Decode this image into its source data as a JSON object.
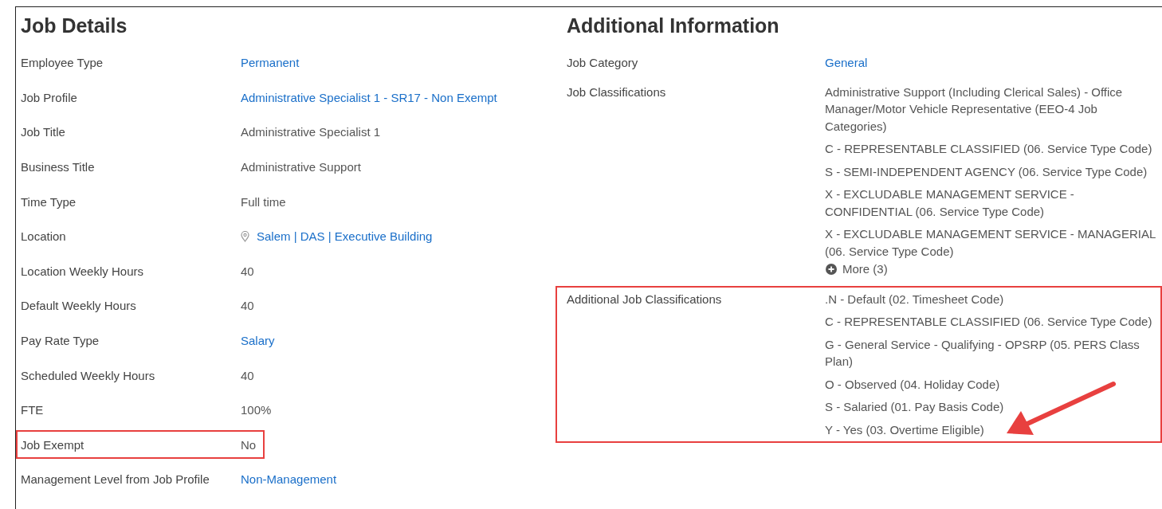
{
  "job_details": {
    "title": "Job Details",
    "fields": [
      {
        "label": "Employee Type",
        "value": "Permanent",
        "kind": "link",
        "highlighted": false
      },
      {
        "label": "Job Profile",
        "value": "Administrative Specialist 1 - SR17 - Non Exempt",
        "kind": "link",
        "highlighted": false
      },
      {
        "label": "Job Title",
        "value": "Administrative Specialist 1",
        "kind": "text",
        "highlighted": false
      },
      {
        "label": "Business Title",
        "value": "Administrative Support",
        "kind": "text",
        "highlighted": false
      },
      {
        "label": "Time Type",
        "value": "Full time",
        "kind": "text",
        "highlighted": false
      },
      {
        "label": "Location",
        "value": "Salem | DAS | Executive Building",
        "kind": "location",
        "highlighted": false
      },
      {
        "label": "Location Weekly Hours",
        "value": "40",
        "kind": "text",
        "highlighted": false
      },
      {
        "label": "Default Weekly Hours",
        "value": "40",
        "kind": "text",
        "highlighted": false
      },
      {
        "label": "Pay Rate Type",
        "value": "Salary",
        "kind": "link",
        "highlighted": false
      },
      {
        "label": "Scheduled Weekly Hours",
        "value": "40",
        "kind": "text",
        "highlighted": false
      },
      {
        "label": "FTE",
        "value": "100%",
        "kind": "text",
        "highlighted": false
      },
      {
        "label": "Job Exempt",
        "value": "No",
        "kind": "text",
        "highlighted": true
      },
      {
        "label": "Management Level from Job Profile",
        "value": "Non-Management",
        "kind": "link",
        "highlighted": false
      }
    ]
  },
  "additional_information": {
    "title": "Additional Information",
    "fields": [
      {
        "label": "Job Category",
        "highlighted": false,
        "values": [
          {
            "text": "General",
            "kind": "link"
          }
        ]
      },
      {
        "label": "Job Classifications",
        "highlighted": false,
        "more": "More (3)",
        "values": [
          {
            "text": "Administrative Support (Including Clerical Sales) - Office Manager/Motor Vehicle Representative (EEO-4 Job Categories)",
            "kind": "text"
          },
          {
            "text": "C - REPRESENTABLE CLASSIFIED (06. Service Type Code)",
            "kind": "text"
          },
          {
            "text": "S - SEMI-INDEPENDENT AGENCY (06. Service Type Code)",
            "kind": "text"
          },
          {
            "text": "X - EXCLUDABLE MANAGEMENT SERVICE - CONFIDENTIAL (06. Service Type Code)",
            "kind": "text"
          },
          {
            "text": "X - EXCLUDABLE MANAGEMENT SERVICE - MANAGERIAL (06. Service Type Code)",
            "kind": "text"
          }
        ]
      },
      {
        "label": "Additional Job Classifications",
        "highlighted": true,
        "values": [
          {
            "text": ".N - Default (02. Timesheet Code)",
            "kind": "text"
          },
          {
            "text": "C - REPRESENTABLE CLASSIFIED (06. Service Type Code)",
            "kind": "text"
          },
          {
            "text": "G - General Service - Qualifying - OPSRP (05. PERS Class Plan)",
            "kind": "text"
          },
          {
            "text": "O - Observed (04. Holiday Code)",
            "kind": "text"
          },
          {
            "text": "S - Salaried (01. Pay Basis Code)",
            "kind": "text"
          },
          {
            "text": "Y - Yes (03. Overtime Eligible)",
            "kind": "text"
          }
        ]
      }
    ]
  }
}
